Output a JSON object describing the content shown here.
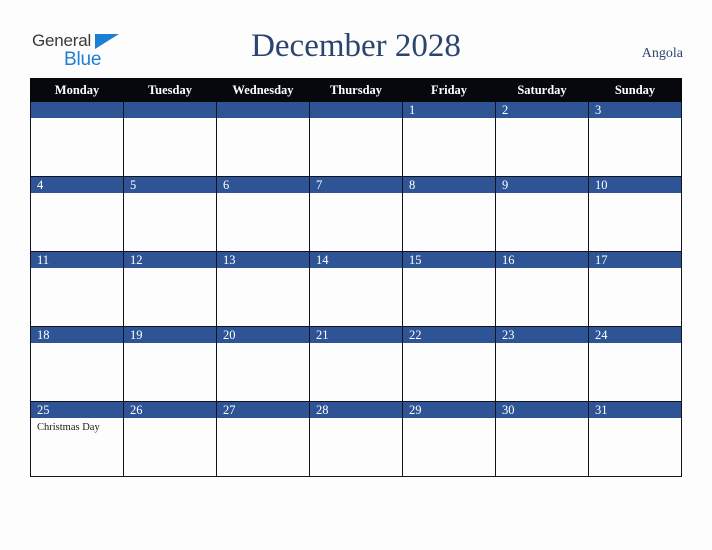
{
  "brand": {
    "name_part1": "General",
    "name_part2": "Blue",
    "triangle_icon": "blue-triangle-icon",
    "accent_color": "#1b7fd4"
  },
  "header": {
    "title": "December 2028",
    "country": "Angola",
    "title_color": "#2b4570"
  },
  "calendar": {
    "header_bg": "#06080d",
    "daybar_bg": "#2f5496",
    "weekday_headers": [
      "Monday",
      "Tuesday",
      "Wednesday",
      "Thursday",
      "Friday",
      "Saturday",
      "Sunday"
    ],
    "weeks": [
      [
        {
          "day": "",
          "events": []
        },
        {
          "day": "",
          "events": []
        },
        {
          "day": "",
          "events": []
        },
        {
          "day": "",
          "events": []
        },
        {
          "day": "1",
          "events": []
        },
        {
          "day": "2",
          "events": []
        },
        {
          "day": "3",
          "events": []
        }
      ],
      [
        {
          "day": "4",
          "events": []
        },
        {
          "day": "5",
          "events": []
        },
        {
          "day": "6",
          "events": []
        },
        {
          "day": "7",
          "events": []
        },
        {
          "day": "8",
          "events": []
        },
        {
          "day": "9",
          "events": []
        },
        {
          "day": "10",
          "events": []
        }
      ],
      [
        {
          "day": "11",
          "events": []
        },
        {
          "day": "12",
          "events": []
        },
        {
          "day": "13",
          "events": []
        },
        {
          "day": "14",
          "events": []
        },
        {
          "day": "15",
          "events": []
        },
        {
          "day": "16",
          "events": []
        },
        {
          "day": "17",
          "events": []
        }
      ],
      [
        {
          "day": "18",
          "events": []
        },
        {
          "day": "19",
          "events": []
        },
        {
          "day": "20",
          "events": []
        },
        {
          "day": "21",
          "events": []
        },
        {
          "day": "22",
          "events": []
        },
        {
          "day": "23",
          "events": []
        },
        {
          "day": "24",
          "events": []
        }
      ],
      [
        {
          "day": "25",
          "events": [
            "Christmas Day"
          ]
        },
        {
          "day": "26",
          "events": []
        },
        {
          "day": "27",
          "events": []
        },
        {
          "day": "28",
          "events": []
        },
        {
          "day": "29",
          "events": []
        },
        {
          "day": "30",
          "events": []
        },
        {
          "day": "31",
          "events": []
        }
      ]
    ]
  }
}
